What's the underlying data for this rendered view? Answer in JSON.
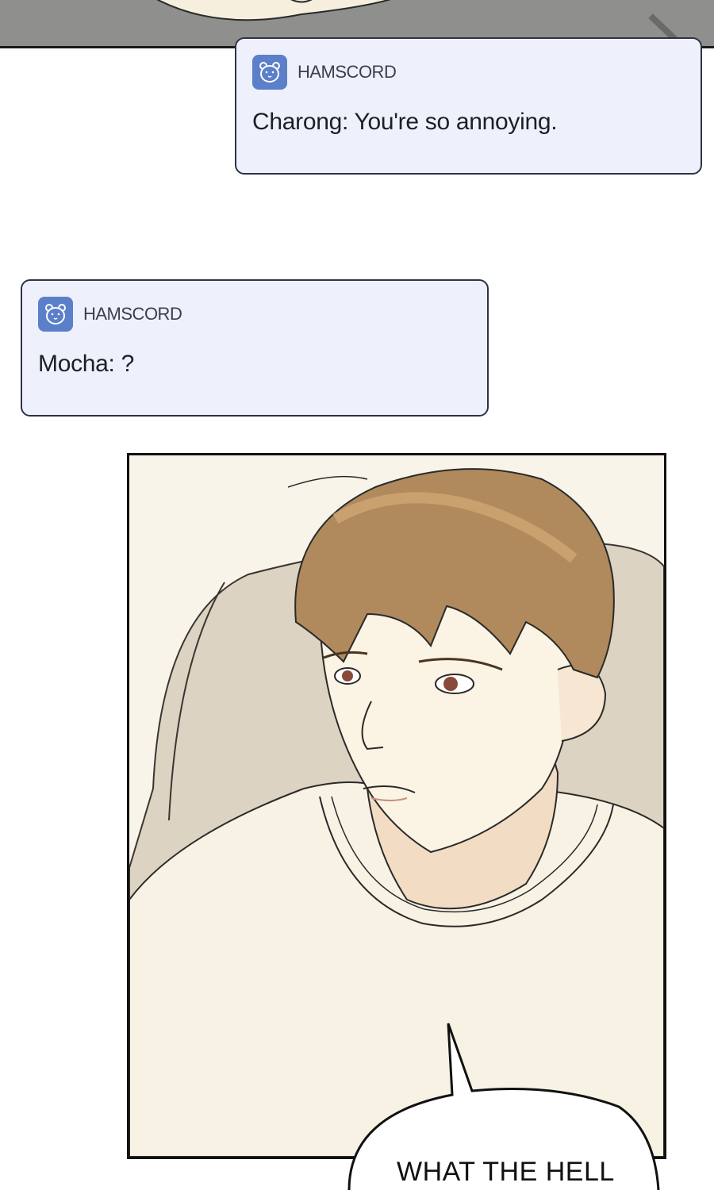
{
  "notifications": [
    {
      "app": "HAMSCORD",
      "message": "Charong: You're so annoying."
    },
    {
      "app": "HAMSCORD",
      "message": "Mocha: ?"
    }
  ],
  "speech_bubble": {
    "text": "WHAT THE HELL"
  },
  "icons": {
    "app_icon": "hamster-icon"
  },
  "colors": {
    "notification_bg": "#eef1fb",
    "notification_border": "#2c3346",
    "app_icon_bg": "#5b7fc9",
    "hair": "#b08a5c",
    "skin": "#fbf3e3",
    "shirt": "#f7f2e4",
    "couch": "#ddd3c2"
  }
}
